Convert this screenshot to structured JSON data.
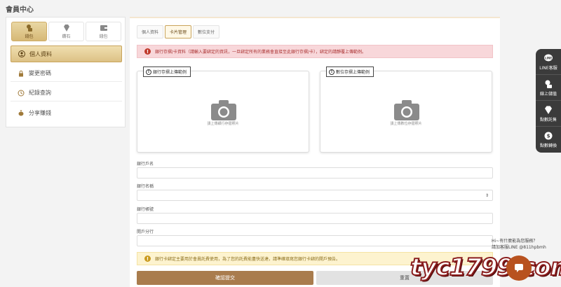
{
  "page_title": "會員中心",
  "top_icons": [
    {
      "label": "錢包",
      "icon": "wallet-coins-icon",
      "active": true
    },
    {
      "label": "鑽石",
      "icon": "diamond-icon",
      "active": false
    },
    {
      "label": "錢包",
      "icon": "wallet-icon",
      "active": false
    }
  ],
  "sidebar": {
    "items": [
      {
        "label": "個人資料",
        "icon": "user-icon",
        "active": true
      },
      {
        "label": "變更密碼",
        "icon": "lock-icon",
        "active": false
      },
      {
        "label": "紀錄查詢",
        "icon": "history-icon",
        "active": false
      },
      {
        "label": "分享賺錢",
        "icon": "money-bag-icon",
        "active": false
      }
    ]
  },
  "tabs": [
    {
      "label": "個人資料",
      "active": false
    },
    {
      "label": "卡片管理",
      "active": true
    },
    {
      "label": "數位支付",
      "active": false
    }
  ],
  "alert_top": "銀行存摺/卡資料（請輸入要綁定的資訊，一旦綁定所有的業務會直接至此銀行存摺/卡），綁定的請靜覆上傳範例。",
  "upload": {
    "front": {
      "label": "銀行存摺上傳範例",
      "hint": "請上傳銀行存摺照片"
    },
    "back": {
      "label": "數位存摺上傳範例",
      "hint": "請上傳數位存摺照片"
    }
  },
  "fields": {
    "account_name": "銀行戶名",
    "bank_code": "銀行名稱",
    "account_number": "銀行帳號",
    "branch": "開戶分行"
  },
  "alert_bottom": "銀行卡綁定主要用於會員託費使用，為了您的託費能盡快送達，請準確填寫您銀行卡綁的開戶預告。",
  "buttons": {
    "submit": "確認提交",
    "reset": "重置"
  },
  "side_menu": [
    {
      "label": "LINE客服",
      "icon": "line-icon"
    },
    {
      "label": "線上儲值",
      "icon": "deposit-icon"
    },
    {
      "label": "點數託售",
      "icon": "diamond-icon"
    },
    {
      "label": "點數轉換",
      "icon": "exchange-icon"
    }
  ],
  "chat": {
    "line1": "Hi~有什麼能為您服務？",
    "line2": "請加客服LINE @811hpbmh"
  },
  "watermark": "tyc1799.com",
  "colors": {
    "gold": "#d6b876",
    "brown_button": "#a97c4d",
    "alert_red_bg": "#f8d7da",
    "alert_yellow_bg": "#fdf3cf",
    "side_bar_bg": "#3b3b3b",
    "chat_orange": "#b8521f"
  }
}
